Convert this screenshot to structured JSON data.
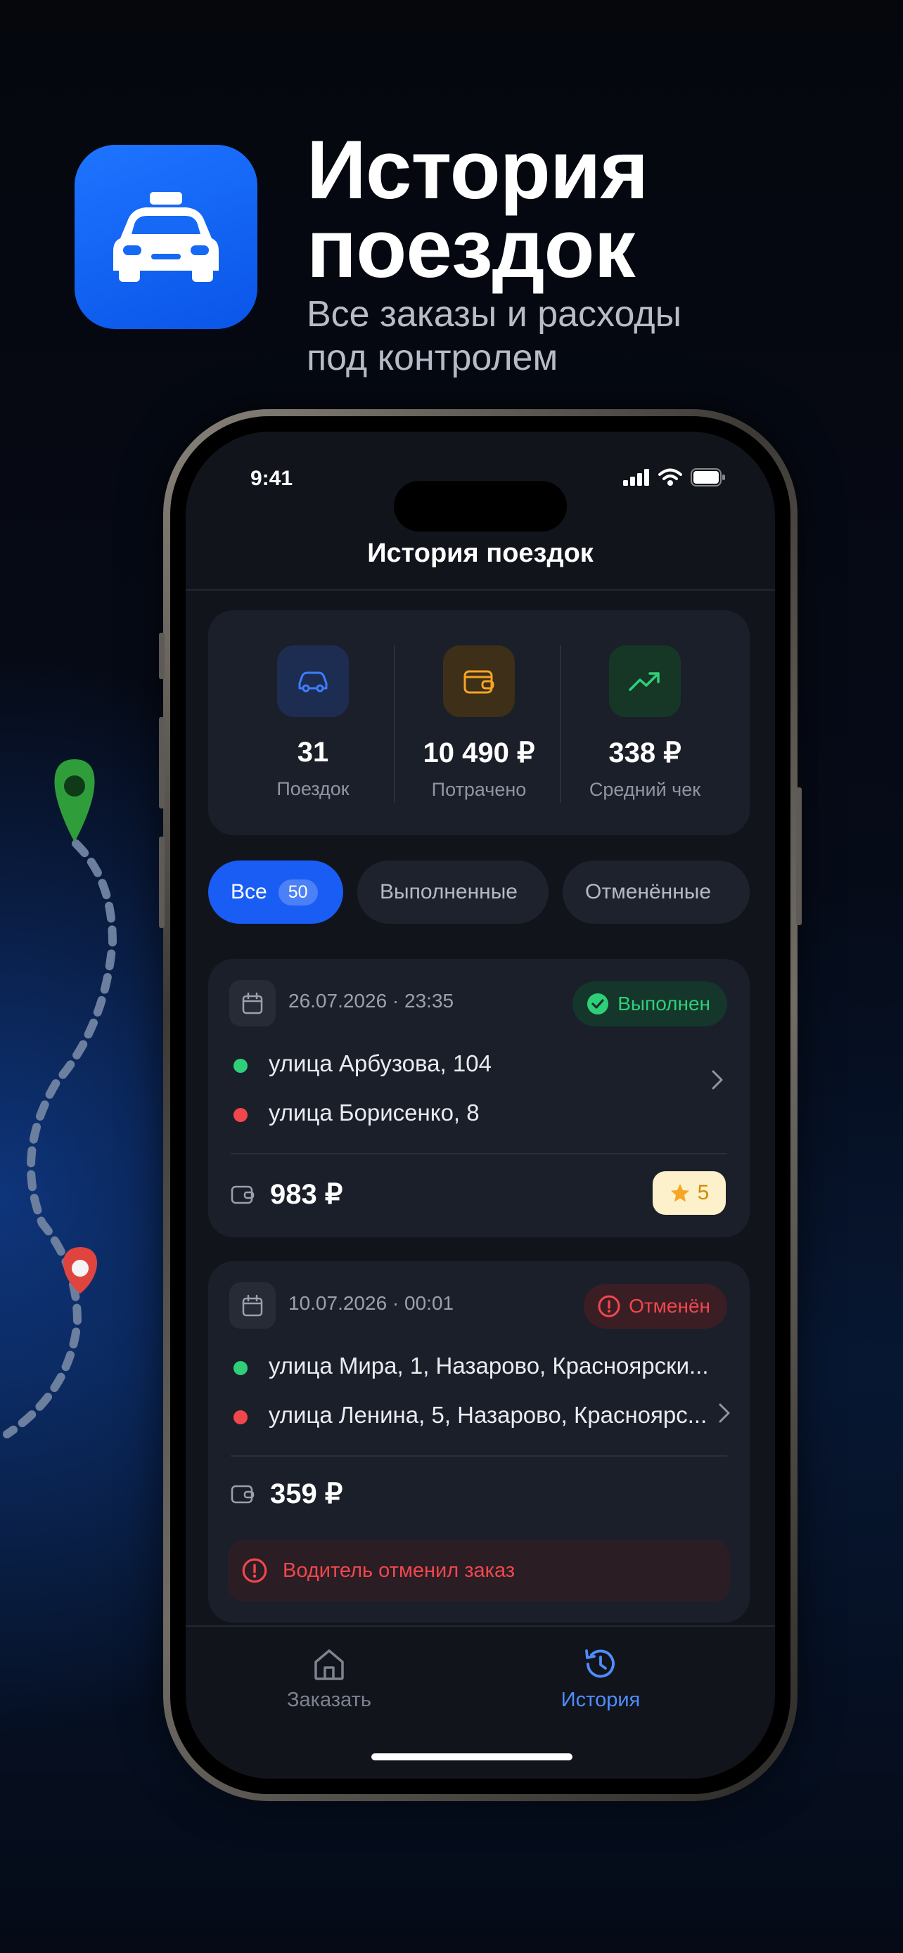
{
  "promo": {
    "headline_line1": "История",
    "headline_line2": "поездок",
    "sub_line1": "Все заказы и расходы",
    "sub_line2": "под контролем",
    "app_icon": "taxi-car-icon"
  },
  "status_bar": {
    "time": "9:41"
  },
  "nav": {
    "title": "История поездок"
  },
  "stats": [
    {
      "icon": "car-icon",
      "value": "31",
      "label": "Поездок",
      "color": "#3d7dff"
    },
    {
      "icon": "wallet-icon",
      "value": "10 490 ₽",
      "label": "Потрачено",
      "color": "#f5a623"
    },
    {
      "icon": "trending-up-icon",
      "value": "338 ₽",
      "label": "Средний чек",
      "color": "#2fcf7a"
    }
  ],
  "filters": {
    "all_label": "Все",
    "all_count": "50",
    "done_label": "Выполненные",
    "cancelled_label": "Отменённые"
  },
  "trips": [
    {
      "date": "26.07.2026 · 23:35",
      "status": "Выполнен",
      "from": "улица Арбузова, 104",
      "to": "улица Борисенко, 8",
      "price": "983 ₽",
      "rating": "5"
    },
    {
      "date": "10.07.2026 · 00:01",
      "status": "Отменён",
      "from": "улица Мира, 1, Назарово, Красноярски...",
      "to": "улица Ленина, 5, Назарово, Красноярс...",
      "price": "359 ₽",
      "note": "Водитель отменил заказ"
    }
  ],
  "tabbar": {
    "order": "Заказать",
    "history": "История"
  },
  "colors": {
    "accent": "#1a5df5",
    "success": "#2fcf7a",
    "danger": "#f0474d",
    "rating": "#f5a623"
  }
}
